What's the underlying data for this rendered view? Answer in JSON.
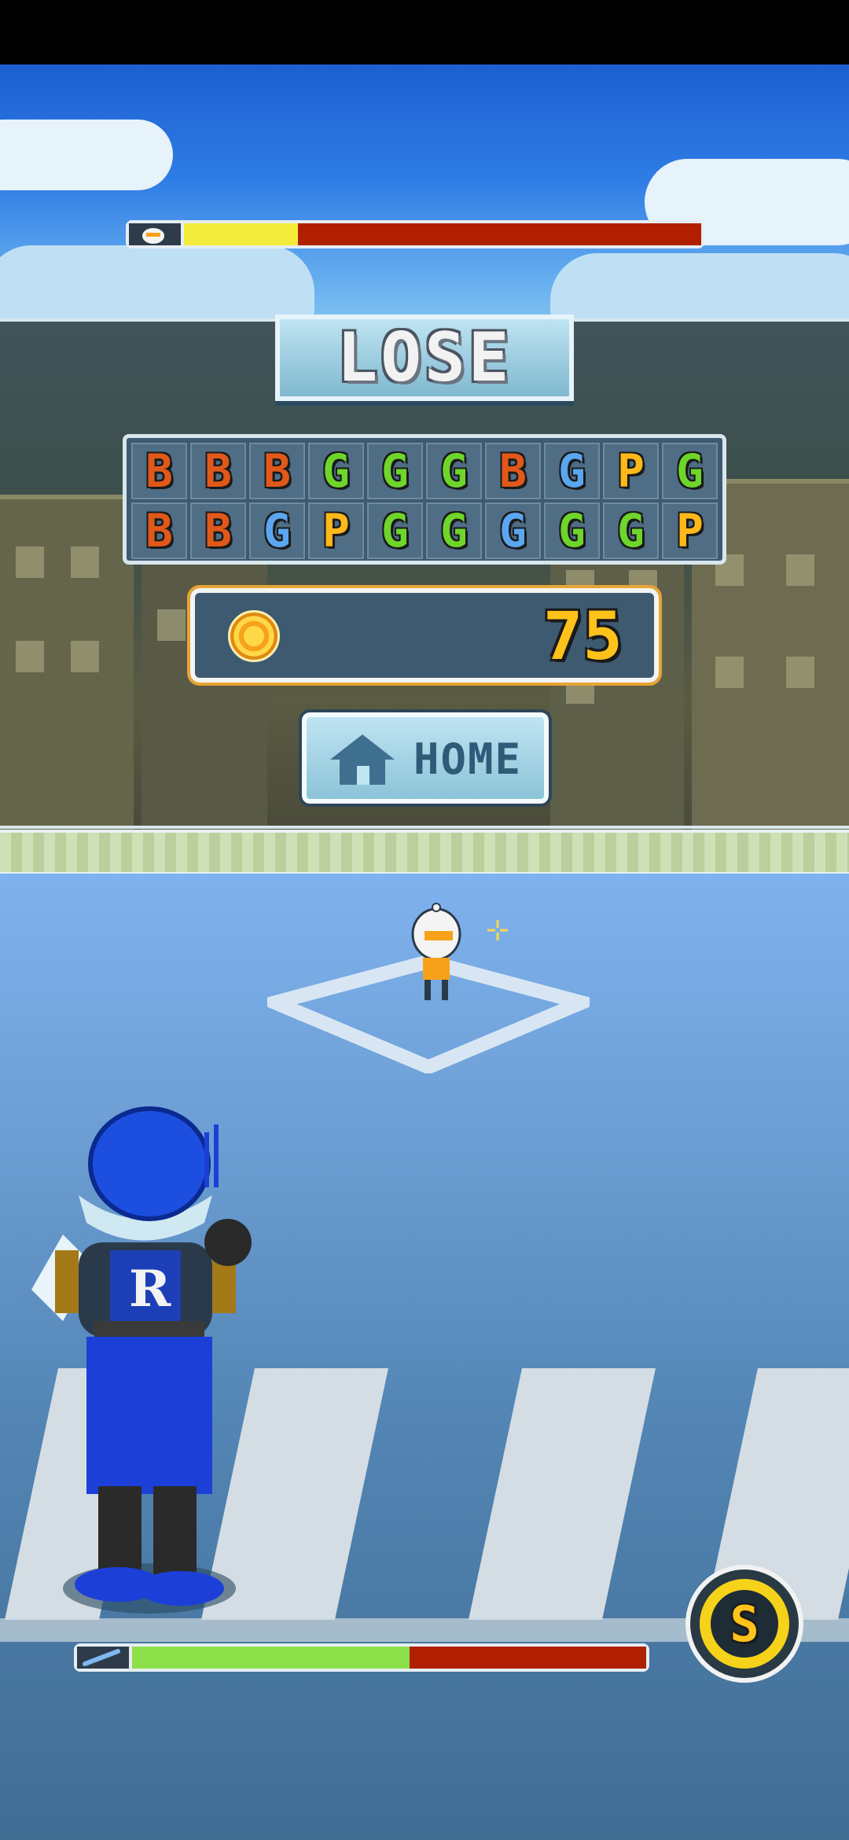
{
  "result": {
    "banner_text": "LOSE"
  },
  "enemy_hp": {
    "icon": "robot-head-icon",
    "fraction": 0.22
  },
  "player_hp": {
    "icon": "bat-icon",
    "fraction": 0.54
  },
  "grades": {
    "row1": [
      "B",
      "B",
      "B",
      "G",
      "G",
      "G",
      "B",
      "G",
      "P",
      "G"
    ],
    "row2": [
      "B",
      "B",
      "G",
      "P",
      "G",
      "G",
      "G",
      "G",
      "G",
      "P"
    ],
    "colors": {
      "B": "#e0581a",
      "G": "#6ed62a",
      "P": "#ffb81a",
      "G_blue": "#5aa6f0"
    }
  },
  "coins": {
    "value": "75",
    "icon": "coin-icon"
  },
  "home_button": {
    "label": "HOME",
    "icon": "house-icon"
  },
  "special_button": {
    "label": "S"
  },
  "player": {
    "jersey_letter": "R"
  }
}
